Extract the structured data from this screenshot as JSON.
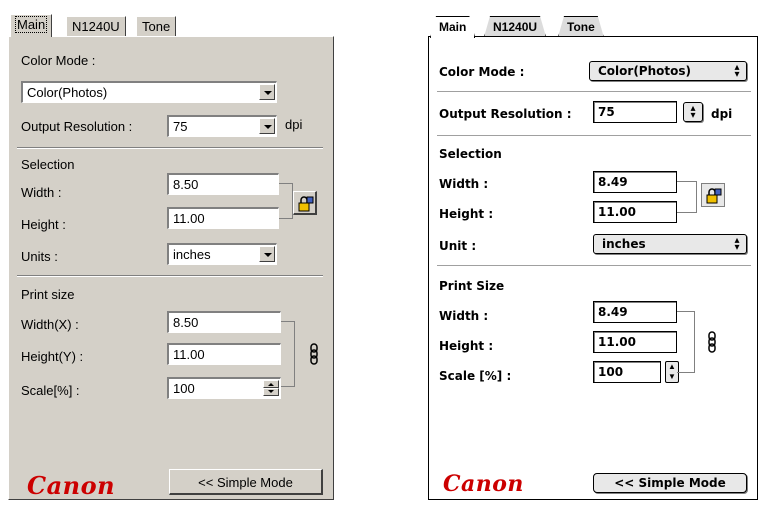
{
  "windows": {
    "tabs": [
      {
        "label": "Main"
      },
      {
        "label": "N1240U"
      },
      {
        "label": "Tone"
      }
    ],
    "color_mode": {
      "label": "Color Mode :",
      "value": "Color(Photos)"
    },
    "output_resolution": {
      "label": "Output Resolution :",
      "value": "75",
      "unit": "dpi"
    },
    "selection": {
      "title": "Selection",
      "width": {
        "label": "Width :",
        "value": "8.50"
      },
      "height": {
        "label": "Height :",
        "value": "11.00"
      },
      "units": {
        "label": "Units :",
        "value": "inches"
      }
    },
    "print_size": {
      "title": "Print size",
      "width": {
        "label": "Width(X) :",
        "value": "8.50"
      },
      "height": {
        "label": "Height(Y) :",
        "value": "11.00"
      },
      "scale": {
        "label": "Scale[%] :",
        "value": "100"
      }
    },
    "logo": "Canon",
    "simple_mode_button": "<< Simple Mode"
  },
  "mac": {
    "tabs": [
      {
        "label": "Main"
      },
      {
        "label": "N1240U"
      },
      {
        "label": "Tone"
      }
    ],
    "color_mode": {
      "label": "Color Mode :",
      "value": "Color(Photos)"
    },
    "output_resolution": {
      "label": "Output Resolution :",
      "value": "75",
      "unit": "dpi"
    },
    "selection": {
      "title": "Selection",
      "width": {
        "label": "Width :",
        "value": "8.49"
      },
      "height": {
        "label": "Height :",
        "value": "11.00"
      },
      "unit": {
        "label": "Unit :",
        "value": "inches"
      }
    },
    "print_size": {
      "title": "Print Size",
      "width": {
        "label": "Width :",
        "value": "8.49"
      },
      "height": {
        "label": "Height :",
        "value": "11.00"
      },
      "scale": {
        "label": "Scale [%] :",
        "value": "100"
      }
    },
    "logo": "Canon",
    "simple_mode_button": "<< Simple Mode"
  },
  "colors": {
    "canon_red": "#cc0000",
    "win_face": "#d4d0c8"
  }
}
